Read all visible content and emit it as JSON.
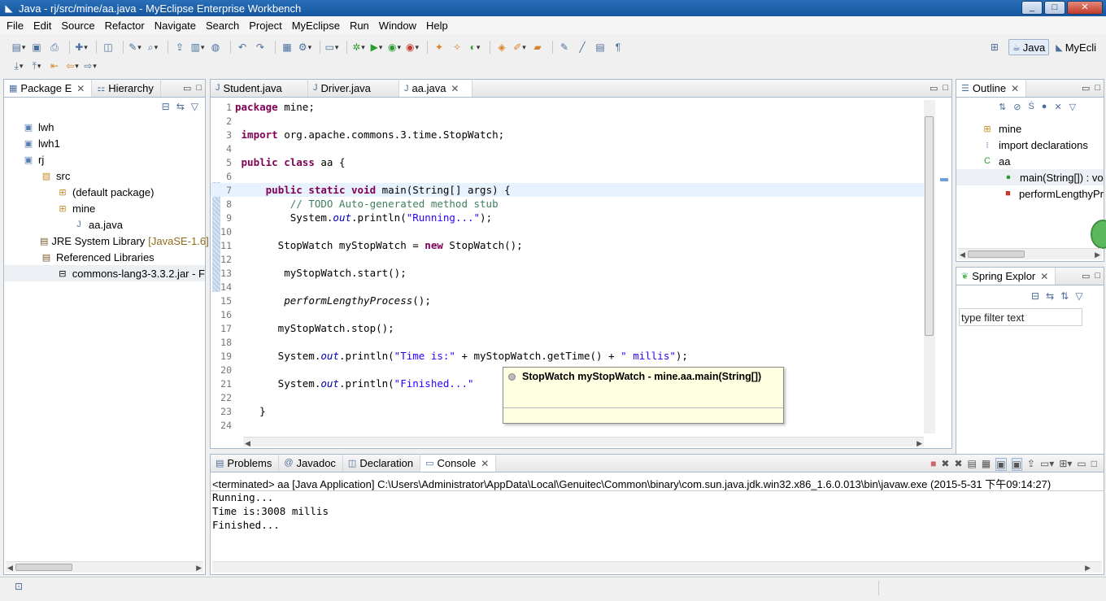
{
  "window": {
    "title": "Java - rj/src/mine/aa.java - MyEclipse Enterprise Workbench",
    "min": "_",
    "max": "□",
    "close": "✕"
  },
  "menu": [
    "File",
    "Edit",
    "Source",
    "Refactor",
    "Navigate",
    "Search",
    "Project",
    "MyEclipse",
    "Run",
    "Window",
    "Help"
  ],
  "perspectives": {
    "java": "Java",
    "myeclipse": "MyEcli"
  },
  "package_explorer": {
    "tabs": [
      "Package E",
      "Hierarchy"
    ],
    "tree": [
      {
        "label": "lwh",
        "level": 1,
        "icon": "project-icon"
      },
      {
        "label": "lwh1",
        "level": 1,
        "icon": "project-icon"
      },
      {
        "label": "rj",
        "level": 1,
        "icon": "project-icon"
      },
      {
        "label": "src",
        "level": 2,
        "icon": "source-folder-icon"
      },
      {
        "label": "(default package)",
        "level": 3,
        "icon": "package-icon"
      },
      {
        "label": "mine",
        "level": 3,
        "icon": "package-icon"
      },
      {
        "label": "aa.java",
        "level": 4,
        "icon": "java-file-icon"
      },
      {
        "label": "JRE System Library",
        "suffix": "[JavaSE-1.6]",
        "level": 2,
        "icon": "library-icon"
      },
      {
        "label": "Referenced Libraries",
        "level": 2,
        "icon": "library-icon"
      },
      {
        "label": "commons-lang3-3.3.2.jar - F",
        "level": 3,
        "icon": "jar-icon",
        "selected": true
      }
    ]
  },
  "editor": {
    "tabs": [
      {
        "label": "Student.java",
        "active": false
      },
      {
        "label": "Driver.java",
        "active": false
      },
      {
        "label": "aa.java",
        "active": true
      }
    ],
    "lines": [
      {
        "n": "1",
        "code": "package mine;"
      },
      {
        "n": "2",
        "code": ""
      },
      {
        "n": "3",
        "code": " import org.apache.commons.lang3.time.StopWatch;"
      },
      {
        "n": "4",
        "code": ""
      },
      {
        "n": "5",
        "code": " public class aa {"
      },
      {
        "n": "6",
        "code": ""
      },
      {
        "n": "7",
        "code": "     public static void main(String[] args) {"
      },
      {
        "n": "8",
        "code": "         // TODO Auto-generated method stub"
      },
      {
        "n": "9",
        "code": "         System.out.println(\"Running...\");"
      },
      {
        "n": "10",
        "code": ""
      },
      {
        "n": "11",
        "code": "       StopWatch myStopWatch = new StopWatch();"
      },
      {
        "n": "12",
        "code": ""
      },
      {
        "n": "13",
        "code": "        myStopWatch.start();"
      },
      {
        "n": "14",
        "code": ""
      },
      {
        "n": "15",
        "code": "        performLengthyProcess();"
      },
      {
        "n": "16",
        "code": ""
      },
      {
        "n": "17",
        "code": "       myStopWatch.stop();"
      },
      {
        "n": "18",
        "code": ""
      },
      {
        "n": "19",
        "code": "       System.out.println(\"Time is:\" + myStopWatch.getTime() + \" millis\");"
      },
      {
        "n": "20",
        "code": ""
      },
      {
        "n": "21",
        "code": "       System.out.println(\"Finished...\""
      },
      {
        "n": "22",
        "code": ""
      },
      {
        "n": "23",
        "code": "    }"
      },
      {
        "n": "24",
        "code": ""
      }
    ],
    "hover": "StopWatch myStopWatch - mine.aa.main(String[])"
  },
  "outline": {
    "title": "Outline",
    "items": [
      {
        "label": "mine",
        "icon": "package-icon"
      },
      {
        "label": "import declarations",
        "icon": "imports-icon"
      },
      {
        "label": "aa",
        "icon": "class-icon"
      },
      {
        "label": "main(String[]) : vo",
        "icon": "public-method-icon",
        "selected": true
      },
      {
        "label": "performLengthyPr",
        "icon": "private-method-icon"
      }
    ]
  },
  "spring": {
    "title": "Spring Explor",
    "filter_placeholder": "type filter text"
  },
  "console": {
    "tabs": [
      "Problems",
      "Javadoc",
      "Declaration",
      "Console"
    ],
    "header": "<terminated> aa [Java Application] C:\\Users\\Administrator\\AppData\\Local\\Genuitec\\Common\\binary\\com.sun.java.jdk.win32.x86_1.6.0.013\\bin\\javaw.exe (2015-5-31 下午09:14:27)",
    "output": [
      "Running...",
      "Time is:3008 millis",
      "Finished..."
    ]
  }
}
